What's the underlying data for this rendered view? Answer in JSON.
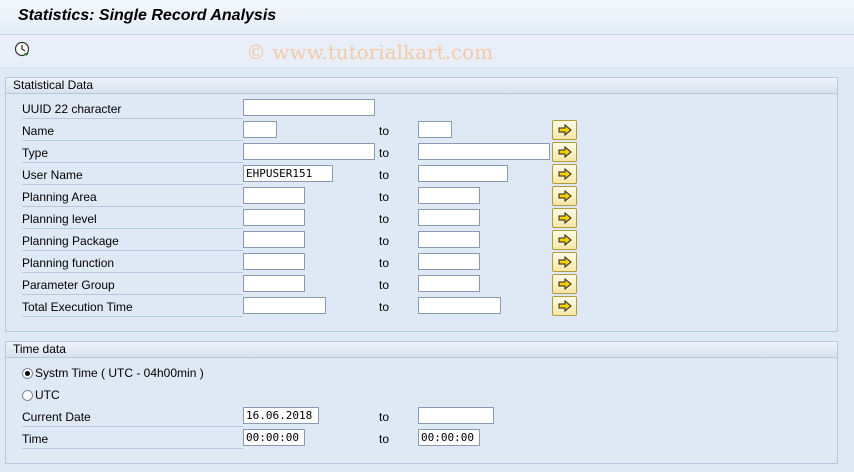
{
  "window": {
    "title": "Statistics: Single Record Analysis"
  },
  "watermark": "© www.tutorialkart.com",
  "statistical_data": {
    "group_title": "Statistical Data",
    "to_label": "to",
    "fields": [
      {
        "label": "UUID 22 character",
        "from": "",
        "to": null
      },
      {
        "label": "Name",
        "from": "",
        "to": ""
      },
      {
        "label": "Type",
        "from": "",
        "to": ""
      },
      {
        "label": "User Name",
        "from": "EHPUSER151",
        "to": ""
      },
      {
        "label": "Planning Area",
        "from": "",
        "to": ""
      },
      {
        "label": "Planning level",
        "from": "",
        "to": ""
      },
      {
        "label": "Planning Package",
        "from": "",
        "to": ""
      },
      {
        "label": "Planning function",
        "from": "",
        "to": ""
      },
      {
        "label": "Parameter Group",
        "from": "",
        "to": ""
      },
      {
        "label": "Total Execution Time",
        "from": "",
        "to": ""
      }
    ]
  },
  "time_data": {
    "group_title": "Time data",
    "options": [
      {
        "label": "Systm Time ( UTC  - 04h00min )",
        "selected": true
      },
      {
        "label": "UTC",
        "selected": false
      }
    ],
    "fields": [
      {
        "label": "Current Date",
        "from": "16.06.2018",
        "to": ""
      },
      {
        "label": "Time",
        "from": "00:00:00",
        "to": "00:00:00"
      }
    ]
  },
  "icons": {
    "execute": "execute-clock-icon",
    "multiple_selection": "multiple-selection-arrow-icon"
  },
  "colors": {
    "background": "#dfe9f5",
    "multiple_selection_button": "#f7e7a6"
  }
}
